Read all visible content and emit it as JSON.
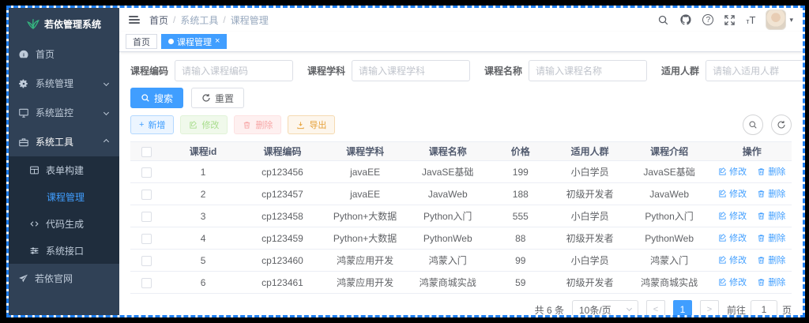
{
  "colors": {
    "accent_blue": "#409eff",
    "sidebar_bg": "#304156",
    "submenu_bg": "#1f2d3d",
    "logo_green": "#35b57f",
    "frame_dashed_border": "#1e7ff2",
    "success_green": "#67c23a",
    "danger_red": "#f56c6c",
    "warning_orange": "#e6a23c"
  },
  "sidebar": {
    "logo_title": "若依管理系统",
    "menu": [
      {
        "label": "首页"
      },
      {
        "label": "系统管理"
      },
      {
        "label": "系统监控"
      },
      {
        "label": "系统工具"
      }
    ],
    "submenu": [
      {
        "label": "表单构建"
      },
      {
        "label": "课程管理"
      },
      {
        "label": "代码生成"
      },
      {
        "label": "系统接口"
      }
    ],
    "site_link": {
      "label": "若依官网"
    }
  },
  "navbar": {
    "breadcrumb": {
      "home": "首页",
      "sep": "/",
      "section": "系统工具",
      "page": "课程管理"
    }
  },
  "tabs": {
    "home": "首页",
    "active": "课程管理"
  },
  "icons": {
    "plus": "+",
    "close": "×",
    "question": "?",
    "caret_down": "▾",
    "chevron_left": "<",
    "chevron_right": ">",
    "font_size_small": "т",
    "font_size_big": "T"
  },
  "search_form": {
    "fields": [
      {
        "label": "课程编码",
        "placeholder": "请输入课程编码"
      },
      {
        "label": "课程学科",
        "placeholder": "请输入课程学科"
      },
      {
        "label": "课程名称",
        "placeholder": "请输入课程名称"
      },
      {
        "label": "适用人群",
        "placeholder": "请输入适用人群"
      }
    ],
    "search_label": "搜索",
    "reset_label": "重置"
  },
  "toolbar": {
    "add_label": "新增",
    "edit_label": "修改",
    "delete_label": "删除",
    "export_label": "导出"
  },
  "table": {
    "columns": [
      "课程id",
      "课程编码",
      "课程学科",
      "课程名称",
      "价格",
      "适用人群",
      "课程介绍",
      "操作"
    ],
    "action_edit": "修改",
    "action_delete": "删除",
    "rows": [
      {
        "id": "1",
        "code": "cp123456",
        "subject": "javaEE",
        "name": "JavaSE基础",
        "price": "199",
        "audience": "小白学员",
        "intro": "JavaSE基础"
      },
      {
        "id": "2",
        "code": "cp123457",
        "subject": "javaEE",
        "name": "JavaWeb",
        "price": "188",
        "audience": "初级开发者",
        "intro": "JavaWeb"
      },
      {
        "id": "3",
        "code": "cp123458",
        "subject": "Python+大数据",
        "name": "Python入门",
        "price": "555",
        "audience": "小白学员",
        "intro": "Python入门"
      },
      {
        "id": "4",
        "code": "cp123459",
        "subject": "Python+大数据",
        "name": "PythonWeb",
        "price": "88",
        "audience": "初级开发者",
        "intro": "PythonWeb"
      },
      {
        "id": "5",
        "code": "cp123460",
        "subject": "鸿蒙应用开发",
        "name": "鸿蒙入门",
        "price": "99",
        "audience": "小白学员",
        "intro": "鸿蒙入门"
      },
      {
        "id": "6",
        "code": "cp123461",
        "subject": "鸿蒙应用开发",
        "name": "鸿蒙商城实战",
        "price": "59",
        "audience": "初级开发者",
        "intro": "鸿蒙商城实战"
      }
    ]
  },
  "pagination": {
    "total": "共 6 条",
    "page_size": "10条/页",
    "current_page": "1",
    "goto_label": "前往",
    "goto_value": "1",
    "page_unit": "页"
  }
}
